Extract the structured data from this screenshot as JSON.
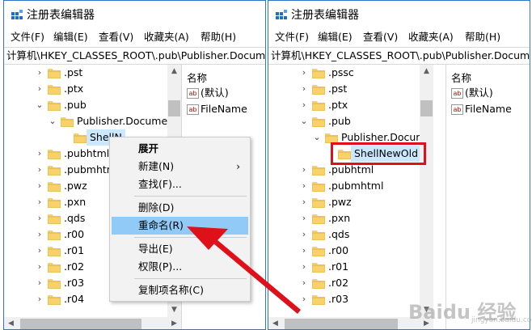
{
  "left": {
    "title": "注册表编辑器",
    "menu": [
      "文件(F)",
      "编辑(E)",
      "查看(V)",
      "收藏夹(A)",
      "帮助(H)"
    ],
    "address": "计算机\\HKEY_CLASSES_ROOT\\.pub\\Publisher.Document",
    "tree": [
      {
        "label": ".pst",
        "twisty": ">"
      },
      {
        "label": ".ptx",
        "twisty": ">"
      },
      {
        "label": ".pub",
        "twisty": "v"
      },
      {
        "label": "Publisher.Documen",
        "twisty": "v"
      },
      {
        "label": "ShellN",
        "twisty": ""
      },
      {
        "label": ".pubhtml",
        "twisty": ">"
      },
      {
        "label": ".pubmhtml",
        "twisty": ">"
      },
      {
        "label": ".pwz",
        "twisty": ">"
      },
      {
        "label": ".pxn",
        "twisty": ">"
      },
      {
        "label": ".qds",
        "twisty": ">"
      },
      {
        "label": ".r00",
        "twisty": ">"
      },
      {
        "label": ".r01",
        "twisty": ">"
      },
      {
        "label": ".r02",
        "twisty": ">"
      },
      {
        "label": ".r03",
        "twisty": ">"
      },
      {
        "label": ".r04",
        "twisty": ">"
      }
    ],
    "values_header": "名称",
    "values": [
      "(默认)",
      "FileName"
    ],
    "context_menu": {
      "items": [
        "展开",
        "新建(N)",
        "查找(F)...",
        "删除(D)",
        "重命名(R)",
        "导出(E)",
        "权限(P)...",
        "复制项名称(C)"
      ],
      "submenu_glyph": ">",
      "highlighted": "重命名(R)"
    }
  },
  "right": {
    "title": "注册表编辑器",
    "menu": [
      "文件(F)",
      "编辑(E)",
      "查看(V)",
      "收藏夹(A)",
      "帮助(H)"
    ],
    "address": "计算机\\HKEY_CLASSES_ROOT\\.pub\\Publisher.Document",
    "tree": [
      {
        "label": ".pssc",
        "twisty": ">"
      },
      {
        "label": ".pst",
        "twisty": ">"
      },
      {
        "label": ".ptx",
        "twisty": ">"
      },
      {
        "label": ".pub",
        "twisty": "v"
      },
      {
        "label": "Publisher.Documen",
        "twisty": "v"
      },
      {
        "label": "ShellNewOld",
        "twisty": ""
      },
      {
        "label": ".pubhtml",
        "twisty": ">"
      },
      {
        "label": ".pubmhtml",
        "twisty": ">"
      },
      {
        "label": ".pwz",
        "twisty": ">"
      },
      {
        "label": ".pxn",
        "twisty": ">"
      },
      {
        "label": ".qds",
        "twisty": ">"
      },
      {
        "label": ".r00",
        "twisty": ">"
      },
      {
        "label": ".r01",
        "twisty": ">"
      },
      {
        "label": ".r02",
        "twisty": ">"
      },
      {
        "label": ".r03",
        "twisty": ">"
      }
    ],
    "values_header": "名称",
    "values": [
      "(默认)",
      "FileName"
    ]
  },
  "watermark": {
    "brand": "Baidu 经验",
    "sub": "jingyan.baidu.com"
  },
  "colors": {
    "accent": "#2c78c7",
    "highlight": "#91c9f7",
    "selection": "#cce8ff",
    "arrow": "#e0101a",
    "folder": "#f7d26b"
  }
}
